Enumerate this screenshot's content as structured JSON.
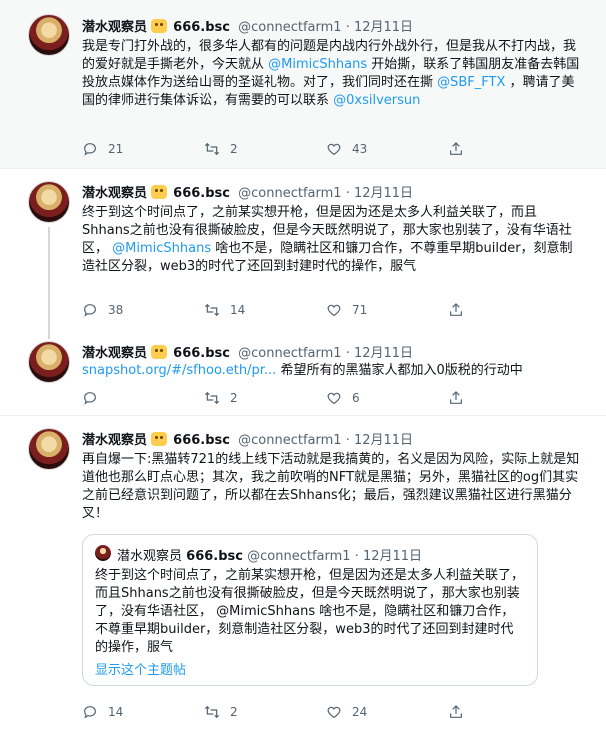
{
  "tweets": [
    {
      "name": "潜水观察员",
      "tag": "666.bsc",
      "handle": "@connectfarm1",
      "dot": "·",
      "date": "12月11日",
      "text": [
        {
          "t": "我是专门打外战的，很多华人都有的问题是内战内行外战外行，但是我从不打内战，我的爱好就是手撕老外，今天就从 "
        },
        {
          "t": "@MimicShhans",
          "link": true
        },
        {
          "t": " 开始撕，联系了韩国朋友准备去韩国投放点媒体作为送给山哥的圣诞礼物。对了，我们同时还在撕 "
        },
        {
          "t": "@SBF_FTX",
          "link": true
        },
        {
          "t": " ，聘请了美国的律师进行集体诉讼，有需要的可以联系 "
        },
        {
          "t": "@0xsilversun",
          "link": true
        }
      ],
      "replies": "21",
      "retweets": "2",
      "likes": "43"
    },
    {
      "name": "潜水观察员",
      "tag": "666.bsc",
      "handle": "@connectfarm1",
      "dot": "·",
      "date": "12月11日",
      "text": [
        {
          "t": "终于到这个时间点了，之前某实想开枪，但是因为还是太多人利益关联了，而且Shhans之前也没有很撕破脸皮，但是今天既然明说了，那大家也别装了，没有华语社区， "
        },
        {
          "t": "@MimicShhans",
          "link": true
        },
        {
          "t": " 啥也不是，隐瞒社区和镰刀合作，不尊重早期builder，刻意制造社区分裂，web3的时代了还回到封建时代的操作，服气"
        }
      ],
      "replies": "38",
      "retweets": "14",
      "likes": "71"
    },
    {
      "name": "潜水观察员",
      "tag": "666.bsc",
      "handle": "@connectfarm1",
      "dot": "·",
      "date": "12月11日",
      "text": [
        {
          "t": "snapshot.org/#/sfhoo.eth/pr...",
          "link": true
        },
        {
          "t": " 希望所有的黑猫家人都加入0版税的行动中"
        }
      ],
      "replies": "",
      "retweets": "2",
      "likes": "6"
    },
    {
      "name": "潜水观察员",
      "tag": "666.bsc",
      "handle": "@connectfarm1",
      "dot": "·",
      "date": "12月11日",
      "text": [
        {
          "t": "再自爆一下:黑猫转721的线上线下活动就是我搞黄的，名义是因为风险，实际上就是知道他也那么盯点心思；其次，我之前吹哨的NFT就是黑猫；另外，黑猫社区的og们其实之前已经意识到问题了，所以都在去Shhans化；最后，强烈建议黑猫社区进行黑猫分叉！"
        }
      ],
      "replies": "14",
      "retweets": "2",
      "likes": "24",
      "quote": {
        "name": "潜水观察员",
        "tag": "666.bsc",
        "handle": "@connectfarm1",
        "dot": "·",
        "date": "12月11日",
        "text": "终于到这个时间点了，之前某实想开枪，但是因为还是太多人利益关联了，而且Shhans之前也没有很撕破脸皮，但是今天既然明说了，那大家也别装了，没有华语社区， @MimicShhans 啥也不是，隐瞒社区和镰刀合作，不尊重早期builder，刻意制造社区分裂，web3的时代了还回到封建时代的操作，服气",
        "more": "显示这个主题帖"
      }
    }
  ],
  "icons": {
    "reply": "reply-icon",
    "retweet": "retweet-icon",
    "like": "heart-icon",
    "share": "share-icon"
  },
  "colors": {
    "link": "#1d9bf0",
    "muted": "#536471",
    "highlight_bg": "#f7f9f9"
  }
}
